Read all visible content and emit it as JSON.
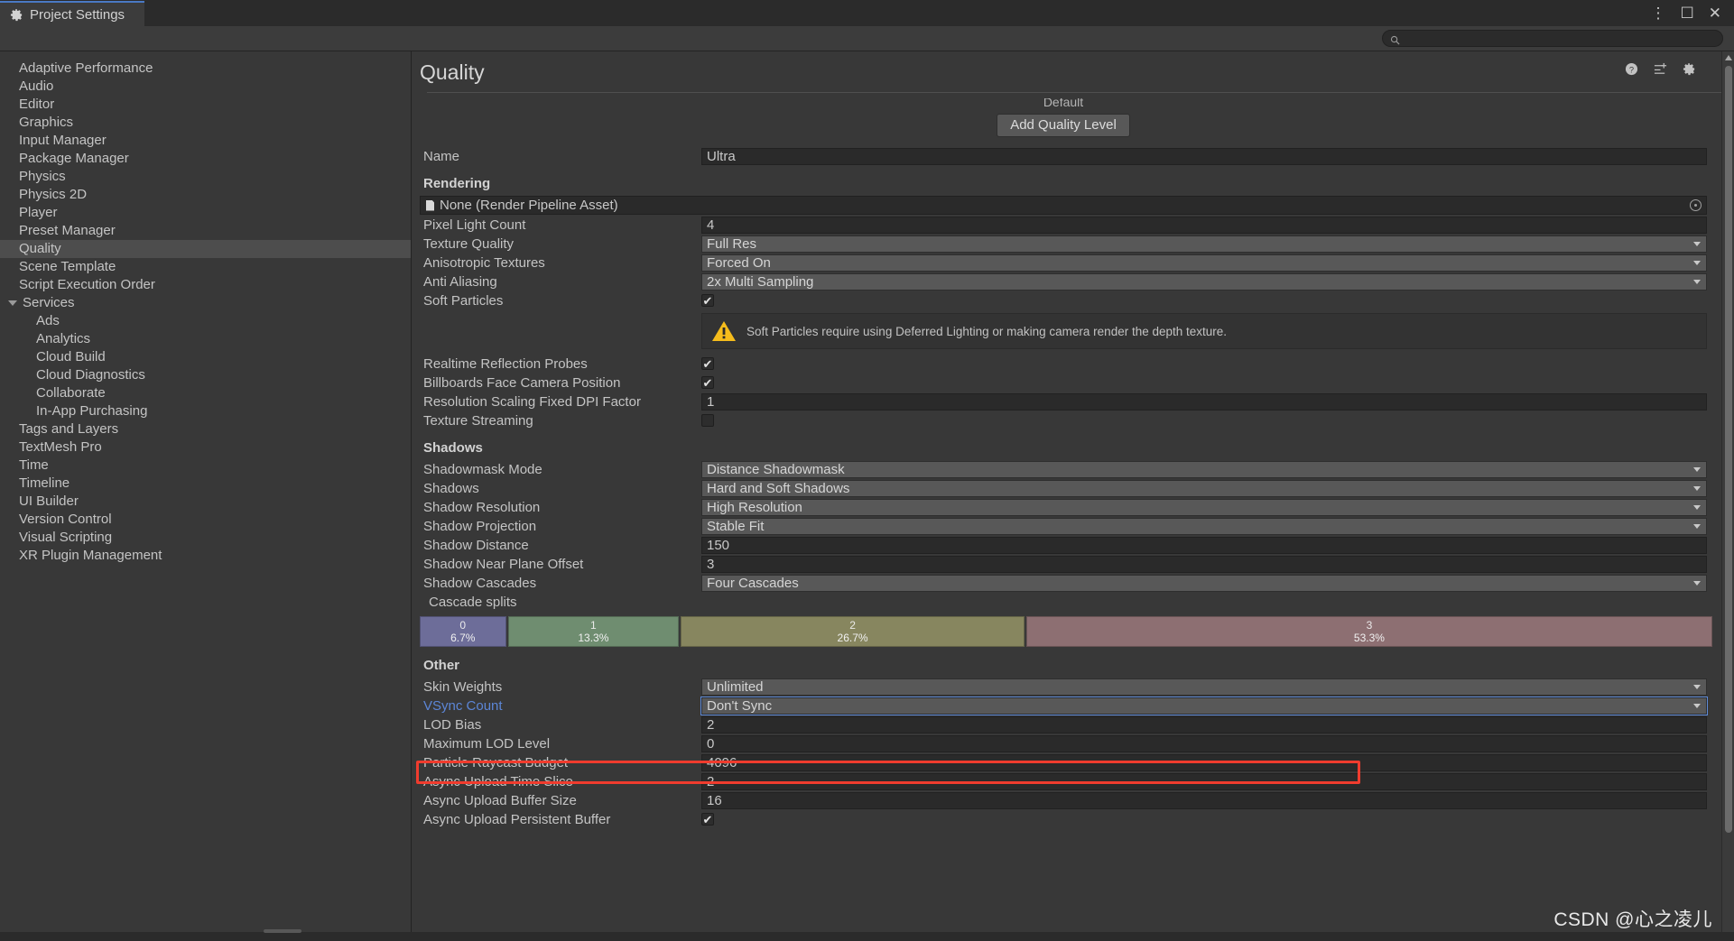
{
  "window": {
    "tab_label": "Project Settings",
    "tab_icon": "gear-icon",
    "more_icon": "kebab-menu-icon",
    "maximize_icon": "maximize-icon",
    "close_icon": "close-icon"
  },
  "search": {
    "value": "",
    "placeholder": "",
    "icon": "search-icon"
  },
  "sidebar": {
    "items": [
      {
        "label": "Adaptive Performance",
        "level": 0,
        "selected": false,
        "expandable": false
      },
      {
        "label": "Audio",
        "level": 0,
        "selected": false,
        "expandable": false
      },
      {
        "label": "Editor",
        "level": 0,
        "selected": false,
        "expandable": false
      },
      {
        "label": "Graphics",
        "level": 0,
        "selected": false,
        "expandable": false
      },
      {
        "label": "Input Manager",
        "level": 0,
        "selected": false,
        "expandable": false
      },
      {
        "label": "Package Manager",
        "level": 0,
        "selected": false,
        "expandable": false
      },
      {
        "label": "Physics",
        "level": 0,
        "selected": false,
        "expandable": false
      },
      {
        "label": "Physics 2D",
        "level": 0,
        "selected": false,
        "expandable": false
      },
      {
        "label": "Player",
        "level": 0,
        "selected": false,
        "expandable": false
      },
      {
        "label": "Preset Manager",
        "level": 0,
        "selected": false,
        "expandable": false
      },
      {
        "label": "Quality",
        "level": 0,
        "selected": true,
        "expandable": false
      },
      {
        "label": "Scene Template",
        "level": 0,
        "selected": false,
        "expandable": false
      },
      {
        "label": "Script Execution Order",
        "level": 0,
        "selected": false,
        "expandable": false
      },
      {
        "label": "Services",
        "level": 0,
        "selected": false,
        "expandable": true
      },
      {
        "label": "Ads",
        "level": 1,
        "selected": false,
        "expandable": false
      },
      {
        "label": "Analytics",
        "level": 1,
        "selected": false,
        "expandable": false
      },
      {
        "label": "Cloud Build",
        "level": 1,
        "selected": false,
        "expandable": false
      },
      {
        "label": "Cloud Diagnostics",
        "level": 1,
        "selected": false,
        "expandable": false
      },
      {
        "label": "Collaborate",
        "level": 1,
        "selected": false,
        "expandable": false
      },
      {
        "label": "In-App Purchasing",
        "level": 1,
        "selected": false,
        "expandable": false
      },
      {
        "label": "Tags and Layers",
        "level": 0,
        "selected": false,
        "expandable": false
      },
      {
        "label": "TextMesh Pro",
        "level": 0,
        "selected": false,
        "expandable": false
      },
      {
        "label": "Time",
        "level": 0,
        "selected": false,
        "expandable": false
      },
      {
        "label": "Timeline",
        "level": 0,
        "selected": false,
        "expandable": false
      },
      {
        "label": "UI Builder",
        "level": 0,
        "selected": false,
        "expandable": false
      },
      {
        "label": "Version Control",
        "level": 0,
        "selected": false,
        "expandable": false
      },
      {
        "label": "Visual Scripting",
        "level": 0,
        "selected": false,
        "expandable": false
      },
      {
        "label": "XR Plugin Management",
        "level": 0,
        "selected": false,
        "expandable": false
      }
    ]
  },
  "main": {
    "title": "Quality",
    "header_icons": [
      "help-icon",
      "preset-icon",
      "gear-icon"
    ],
    "clipped_label": "Default",
    "add_quality_level_label": "Add Quality Level",
    "name_label": "Name",
    "name_value": "Ultra",
    "sections": {
      "rendering": {
        "title": "Rendering",
        "render_pipeline_asset": "None (Render Pipeline Asset)",
        "rows": [
          {
            "label": "Pixel Light Count",
            "type": "text",
            "value": "4"
          },
          {
            "label": "Texture Quality",
            "type": "dropdown",
            "value": "Full Res"
          },
          {
            "label": "Anisotropic Textures",
            "type": "dropdown",
            "value": "Forced On"
          },
          {
            "label": "Anti Aliasing",
            "type": "dropdown",
            "value": "2x Multi Sampling"
          },
          {
            "label": "Soft Particles",
            "type": "checkbox",
            "value": true
          }
        ],
        "warning": "Soft Particles require using Deferred Lighting or making camera render the depth texture.",
        "rows2": [
          {
            "label": "Realtime Reflection Probes",
            "type": "checkbox",
            "value": true
          },
          {
            "label": "Billboards Face Camera Position",
            "type": "checkbox",
            "value": true
          },
          {
            "label": "Resolution Scaling Fixed DPI Factor",
            "type": "text",
            "value": "1"
          },
          {
            "label": "Texture Streaming",
            "type": "checkbox",
            "value": false
          }
        ]
      },
      "shadows": {
        "title": "Shadows",
        "rows": [
          {
            "label": "Shadowmask Mode",
            "type": "dropdown",
            "value": "Distance Shadowmask"
          },
          {
            "label": "Shadows",
            "type": "dropdown",
            "value": "Hard and Soft Shadows"
          },
          {
            "label": "Shadow Resolution",
            "type": "dropdown",
            "value": "High Resolution"
          },
          {
            "label": "Shadow Projection",
            "type": "dropdown",
            "value": "Stable Fit"
          },
          {
            "label": "Shadow Distance",
            "type": "text",
            "value": "150"
          },
          {
            "label": "Shadow Near Plane Offset",
            "type": "text",
            "value": "3"
          },
          {
            "label": "Shadow Cascades",
            "type": "dropdown",
            "value": "Four Cascades"
          }
        ],
        "cascade_splits_label": "Cascade splits",
        "cascades": [
          {
            "index": "0",
            "percent": "6.7%",
            "value": 6.7,
            "color": "#6d6d99"
          },
          {
            "index": "1",
            "percent": "13.3%",
            "value": 13.3,
            "color": "#6f8d70"
          },
          {
            "index": "2",
            "percent": "26.7%",
            "value": 26.7,
            "color": "#87865f"
          },
          {
            "index": "3",
            "percent": "53.3%",
            "value": 53.3,
            "color": "#8d6f72"
          }
        ]
      },
      "other": {
        "title": "Other",
        "rows": [
          {
            "label": "Skin Weights",
            "type": "dropdown",
            "value": "Unlimited",
            "highlighted": false
          },
          {
            "label": "VSync Count",
            "type": "dropdown",
            "value": "Don't Sync",
            "highlighted": true
          },
          {
            "label": "LOD Bias",
            "type": "text",
            "value": "2",
            "highlighted": false
          },
          {
            "label": "Maximum LOD Level",
            "type": "text",
            "value": "0",
            "highlighted": false
          },
          {
            "label": "Particle Raycast Budget",
            "type": "text",
            "value": "4096",
            "highlighted": false
          },
          {
            "label": "Async Upload Time Slice",
            "type": "text",
            "value": "2",
            "highlighted": false
          },
          {
            "label": "Async Upload Buffer Size",
            "type": "text",
            "value": "16",
            "highlighted": false
          },
          {
            "label": "Async Upload Persistent Buffer",
            "type": "checkbox",
            "value": true,
            "highlighted": false
          }
        ]
      }
    }
  },
  "watermark": "CSDN @心之凌儿",
  "colors": {
    "highlight_border": "#f03c2e",
    "selection_blue": "#4a79c4",
    "panel_bg": "#383838",
    "field_bg": "#2a2a2a",
    "dropdown_bg": "#585858"
  }
}
